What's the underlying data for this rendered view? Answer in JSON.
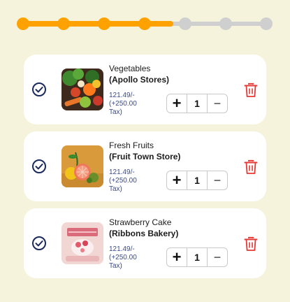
{
  "progress": {
    "total_steps": 7,
    "completed_steps": 4,
    "fraction": 0.62
  },
  "colors": {
    "accent": "#ffa200",
    "inactive": "#cfcfcf",
    "delete": "#e53935",
    "check": "#1a2a5c",
    "price": "#3a4a8a"
  },
  "cart": {
    "items": [
      {
        "name": "Vegetables",
        "store": "(Apollo Stores)",
        "price": "121.49/-",
        "tax": "(+250.00 Tax)",
        "qty": "1",
        "image": "vegetables-image"
      },
      {
        "name": "Fresh Fruits",
        "store": "(Fruit Town Store)",
        "price": "121.49/-",
        "tax": "(+250.00 Tax)",
        "qty": "1",
        "image": "fruits-image"
      },
      {
        "name": "Strawberry Cake",
        "store": "(Ribbons Bakery)",
        "price": "121.49/-",
        "tax": "(+250.00 Tax)",
        "qty": "1",
        "image": "cake-image"
      }
    ],
    "plus_label": "+",
    "minus_label": "−"
  }
}
